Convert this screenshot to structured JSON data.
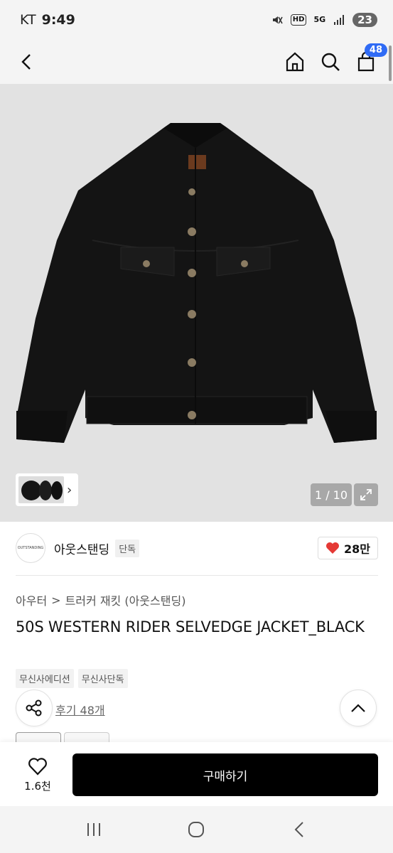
{
  "status_bar": {
    "carrier": "KT",
    "time": "9:49",
    "hd_label": "HD",
    "network_label": "5G",
    "battery_level": "23"
  },
  "nav": {
    "cart_count": "48"
  },
  "gallery": {
    "counter": "1 / 10"
  },
  "brand": {
    "logo_text": "OUTSTANDING",
    "name": "아웃스탠딩",
    "badge": "단독",
    "like_count": "28만"
  },
  "breadcrumb": {
    "category": "아우터",
    "separator": ">",
    "subcategory": "트러커 재킷 (아웃스탠딩)"
  },
  "product": {
    "title": "50S WESTERN RIDER SELVEDGE JACKET_BLACK",
    "tags": [
      "무신사에디션",
      "무신사단독"
    ],
    "review_link": "후기 48개"
  },
  "bottom_bar": {
    "wish_count": "1.6천",
    "buy_label": "구매하기"
  },
  "colors": {
    "accent_blue": "#2f6bf5",
    "heart_red": "#e53935",
    "buy_button": "#000000"
  },
  "icons": [
    "back-arrow-icon",
    "home-icon",
    "search-icon",
    "cart-icon",
    "expand-icon",
    "heart-icon",
    "share-icon",
    "chevron-up-icon",
    "recent-apps-icon",
    "home-circle-icon",
    "system-back-icon"
  ]
}
